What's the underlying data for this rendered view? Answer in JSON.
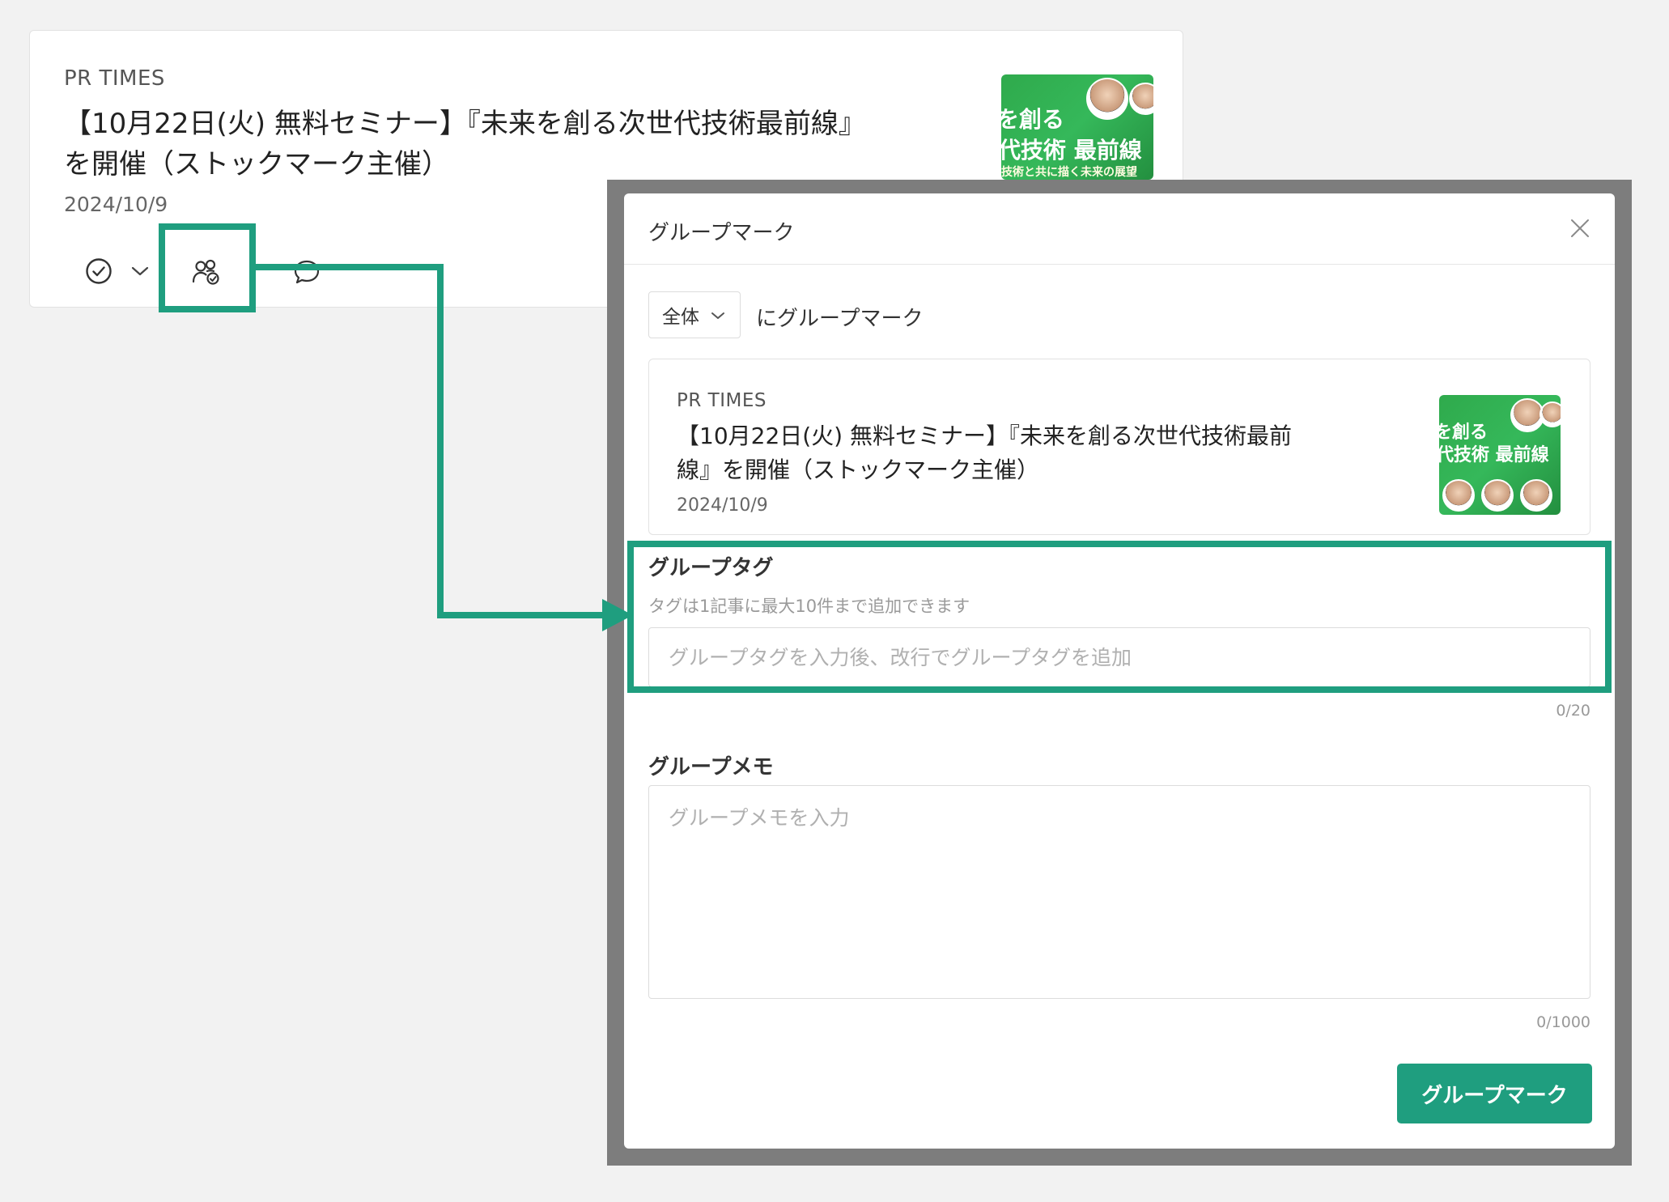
{
  "colors": {
    "accent": "#1f9e7f",
    "thumbnail_green": "#2faa4c"
  },
  "article": {
    "source": "PR TIMES",
    "title_line1": "【10月22日(火) 無料セミナー】『未来を創る次世代技術最前線』",
    "title_line2": "を開催（ストックマーク主催）",
    "date": "2024/10/9",
    "thumb_text1": "を創る",
    "thumb_text2": "代技術 最前線",
    "thumb_text3": "技術と共に描く未来の展望",
    "icons": [
      "check-circle-icon",
      "chevron-down-icon",
      "group-mark-icon",
      "comment-icon"
    ]
  },
  "modal": {
    "title": "グループマーク",
    "scope_select": {
      "value": "全体"
    },
    "scope_suffix": "にグループマーク",
    "preview": {
      "source": "PR TIMES",
      "title_line1": "【10月22日(火) 無料セミナー】『未来を創る次世代技術最前",
      "title_line2": "線』を開催（ストックマーク主催）",
      "date": "2024/10/9",
      "thumb_text1": "を創る",
      "thumb_text2": "代技術 最前線"
    },
    "group_tag": {
      "label": "グループタグ",
      "hint": "タグは1記事に最大10件まで追加できます",
      "placeholder": "グループタグを入力後、改行でグループタグを追加",
      "counter": "0/20"
    },
    "group_memo": {
      "label": "グループメモ",
      "placeholder": "グループメモを入力",
      "counter": "0/1000"
    },
    "submit_label": "グループマーク"
  }
}
